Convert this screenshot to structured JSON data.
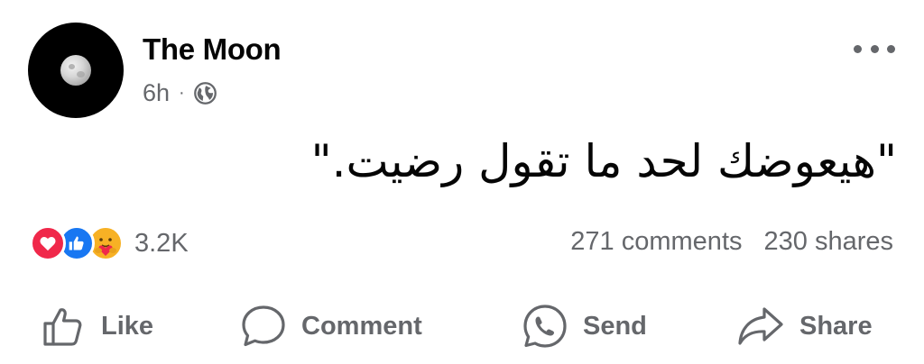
{
  "post": {
    "author": "The Moon",
    "time": "6h",
    "separator": "·",
    "audience_icon": "globe-icon",
    "text": "\"هيعوضك لحد ما تقول رضيت.\""
  },
  "reactions": {
    "icons": [
      "love-reaction-icon",
      "like-reaction-icon",
      "care-reaction-icon"
    ],
    "count": "3.2K"
  },
  "stats": {
    "comments": "271 comments",
    "shares": "230 shares"
  },
  "actions": {
    "like": "Like",
    "comment": "Comment",
    "send": "Send",
    "share": "Share"
  },
  "colors": {
    "secondary_text": "#65676b",
    "love": "#f0284a",
    "like": "#1877f2",
    "care": "#f7b125"
  }
}
